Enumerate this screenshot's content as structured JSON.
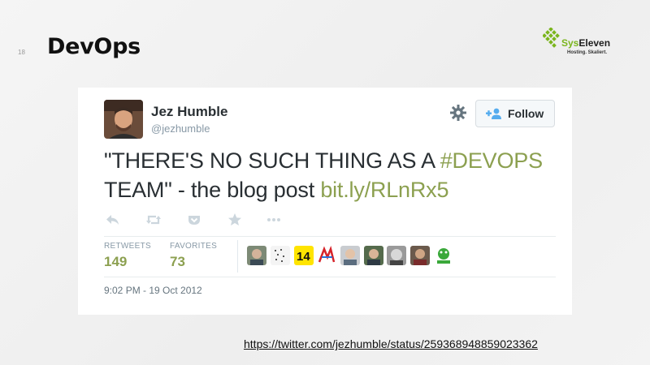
{
  "slide": {
    "number": "18",
    "title": "DevOps",
    "source_url": "https://twitter.com/jezhumble/status/259368948859023362"
  },
  "logo": {
    "name_prefix": "Sys",
    "name_suffix": "Eleven",
    "tagline": "Hosting. Skaliert.",
    "brand_color": "#7ab51d"
  },
  "tweet": {
    "author_name": "Jez Humble",
    "author_handle": "@jezhumble",
    "follow_label": "Follow",
    "text_plain": "\"THERE'S NO SUCH THING AS A ",
    "hashtag": "#DEVOPS",
    "text_plain2": " TEAM\" - the blog post ",
    "link": "bit.ly/RLnRx5",
    "link_color": "#8ca050",
    "retweets_label": "RETWEETS",
    "retweets_count": "149",
    "favorites_label": "FAVORITES",
    "favorites_count": "73",
    "timestamp": "9:02 PM - 19 Oct 2012",
    "action_icons": [
      "reply-icon",
      "retweet-icon",
      "pocket-icon",
      "favorite-icon",
      "more-icon"
    ],
    "favoriter_avatars": 9
  }
}
